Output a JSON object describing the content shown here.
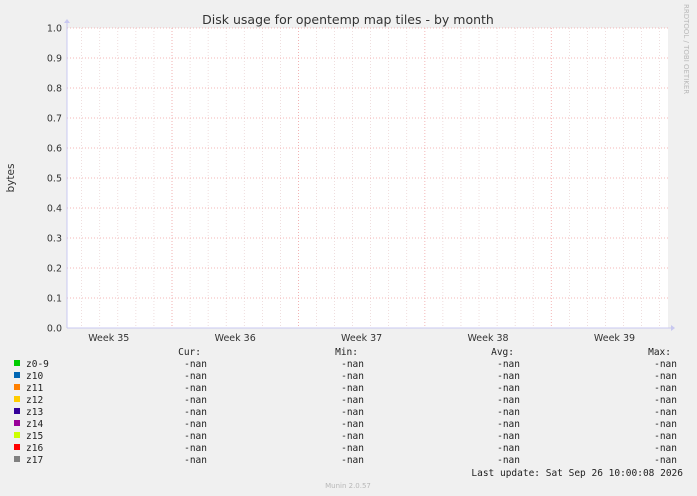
{
  "chart_data": {
    "type": "area",
    "title": "Disk usage for opentemp map tiles - by month",
    "ylabel": "bytes",
    "xlabel": "",
    "categories": [
      "Week 35",
      "Week 36",
      "Week 37",
      "Week 38",
      "Week 39"
    ],
    "ylim": [
      0,
      1.0
    ],
    "yticks": [
      "0.0",
      "0.1",
      "0.2",
      "0.3",
      "0.4",
      "0.5",
      "0.6",
      "0.7",
      "0.8",
      "0.9",
      "1.0"
    ],
    "grid": true,
    "watermark": "RRDTOOL / TOBI OETIKER",
    "series": [
      {
        "name": "z0-9",
        "color": "#00cc00",
        "values": [],
        "cur": "-nan",
        "min": "-nan",
        "avg": "-nan",
        "max": "-nan"
      },
      {
        "name": "z10",
        "color": "#0066b3",
        "values": [],
        "cur": "-nan",
        "min": "-nan",
        "avg": "-nan",
        "max": "-nan"
      },
      {
        "name": "z11",
        "color": "#ff8000",
        "values": [],
        "cur": "-nan",
        "min": "-nan",
        "avg": "-nan",
        "max": "-nan"
      },
      {
        "name": "z12",
        "color": "#ffcc00",
        "values": [],
        "cur": "-nan",
        "min": "-nan",
        "avg": "-nan",
        "max": "-nan"
      },
      {
        "name": "z13",
        "color": "#330099",
        "values": [],
        "cur": "-nan",
        "min": "-nan",
        "avg": "-nan",
        "max": "-nan"
      },
      {
        "name": "z14",
        "color": "#990099",
        "values": [],
        "cur": "-nan",
        "min": "-nan",
        "avg": "-nan",
        "max": "-nan"
      },
      {
        "name": "z15",
        "color": "#ccff00",
        "values": [],
        "cur": "-nan",
        "min": "-nan",
        "avg": "-nan",
        "max": "-nan"
      },
      {
        "name": "z16",
        "color": "#ff0000",
        "values": [],
        "cur": "-nan",
        "min": "-nan",
        "avg": "-nan",
        "max": "-nan"
      },
      {
        "name": "z17",
        "color": "#808080",
        "values": [],
        "cur": "-nan",
        "min": "-nan",
        "avg": "-nan",
        "max": "-nan"
      }
    ],
    "legend_headers": {
      "cur": "Cur:",
      "min": "Min:",
      "avg": "Avg:",
      "max": "Max:"
    },
    "last_update": "Last update: Sat Sep 26 10:00:08 2026",
    "footer": "Munin 2.0.57"
  }
}
